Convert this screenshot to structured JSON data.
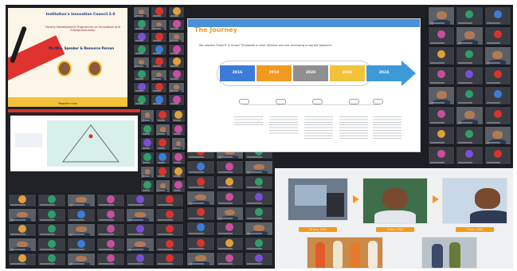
{
  "flyer": {
    "title": "Institution's Innovation Council 3.0",
    "subtitle": "Faculty Development Programme on Innovation and Entrepreneurship",
    "speakers": "Mr./Mrs. Speaker & Resource Person",
    "footer": "Register now"
  },
  "slide": {
    "title": "The Journey",
    "intro": "We started TinkerIT & Smart Timetable in their lifetime and are reviewing a market footprint.",
    "milestones": [
      "2016",
      "2018",
      "2020",
      "2022",
      "2024"
    ],
    "milestone_colors": [
      "#3c7cd9",
      "#f29a1f",
      "#8f8f8f",
      "#f2c23b",
      "#3c9ad9"
    ]
  },
  "photos": {
    "labels": [
      "25 Aug, 2022",
      "4 Sep, 2022",
      "3 Sep, 2022"
    ]
  }
}
